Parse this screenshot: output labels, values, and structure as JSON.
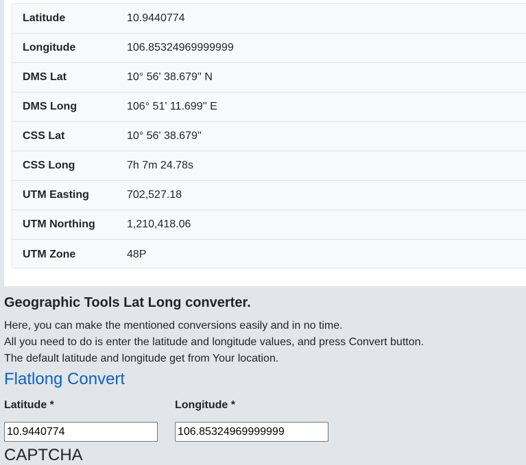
{
  "results": {
    "rows": [
      {
        "label": "Latitude",
        "value": "10.9440774"
      },
      {
        "label": "Longitude",
        "value": "106.85324969999999"
      },
      {
        "label": "DMS Lat",
        "value": "10° 56' 38.679'' N"
      },
      {
        "label": "DMS Long",
        "value": "106° 51' 11.699'' E"
      },
      {
        "label": "CSS Lat",
        "value": "10° 56' 38.679''"
      },
      {
        "label": "CSS Long",
        "value": "7h 7m 24.78s"
      },
      {
        "label": "UTM Easting",
        "value": "702,527.18"
      },
      {
        "label": "UTM Northing",
        "value": "1,210,418.06"
      },
      {
        "label": "UTM Zone",
        "value": "48P"
      }
    ]
  },
  "info": {
    "heading": "Geographic Tools Lat Long converter.",
    "line1": "Here, you can make the mentioned conversions easily and in no time.",
    "line2": "All you need to do is enter the latitude and longitude values, and press Convert button.",
    "line3": "The default latitude and longitude get from Your location."
  },
  "form": {
    "title": "Flatlong Convert",
    "latitude_label": "Latitude *",
    "latitude_value": "10.9440774",
    "longitude_label": "Longitude *",
    "longitude_value": "106.85324969999999",
    "captcha_label": "CAPTCHA"
  },
  "colors": {
    "accent": "#0b63c7",
    "page_bg": "#e2e5e9",
    "table_bg": "#f8f9fa"
  }
}
